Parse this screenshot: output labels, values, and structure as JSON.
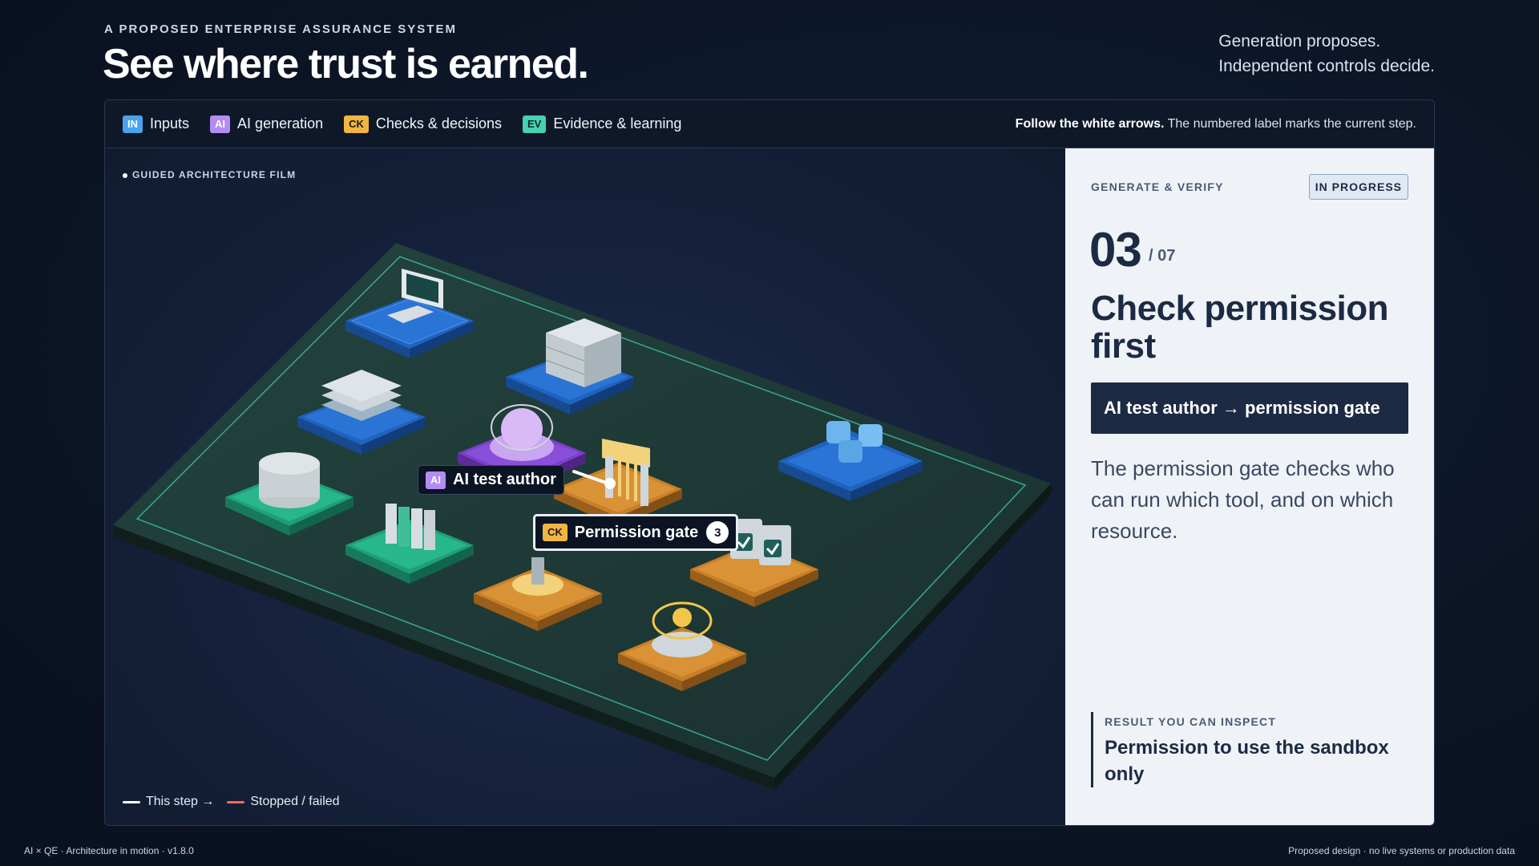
{
  "header": {
    "eyebrow": "A PROPOSED ENTERPRISE ASSURANCE SYSTEM",
    "headline": "See where trust is earned.",
    "tagline_1": "Generation proposes.",
    "tagline_2": "Independent controls decide."
  },
  "legend": {
    "items": [
      {
        "tag": "IN",
        "label": "Inputs",
        "color": "#4aa3ef"
      },
      {
        "tag": "AI",
        "label": "AI generation",
        "color": "#b48cf2"
      },
      {
        "tag": "CK",
        "label": "Checks & decisions",
        "color": "#f3b541"
      },
      {
        "tag": "EV",
        "label": "Evidence & learning",
        "color": "#46d1b0"
      }
    ],
    "hint_bold": "Follow the white arrows.",
    "hint_rest": " The numbered label marks the current step."
  },
  "stage": {
    "film_label": "GUIDED ARCHITECTURE FILM",
    "callout_ai": {
      "tag": "AI",
      "label": "AI test author"
    },
    "callout_ck": {
      "tag": "CK",
      "label": "Permission gate",
      "step": "3"
    },
    "legend_this_step": "This step →",
    "legend_stopped": "Stopped / failed",
    "colors": {
      "this_step": "#ffffff",
      "stopped": "#ef6b5f",
      "board": "#1f3b38",
      "board_edge": "#3fc6a6"
    }
  },
  "panel": {
    "section": "GENERATE & VERIFY",
    "status": "IN PROGRESS",
    "step": "03",
    "total": "/ 07",
    "title": "Check permission first",
    "flow": "AI test author → permission gate",
    "description": "The permission gate checks who can run which tool, and on which resource.",
    "result_label": "RESULT YOU CAN INSPECT",
    "result_value": "Permission to use the sandbox only"
  },
  "footer": {
    "left": "AI × QE · Architecture in motion · v1.8.0",
    "right": "Proposed design · no live systems or production data"
  }
}
